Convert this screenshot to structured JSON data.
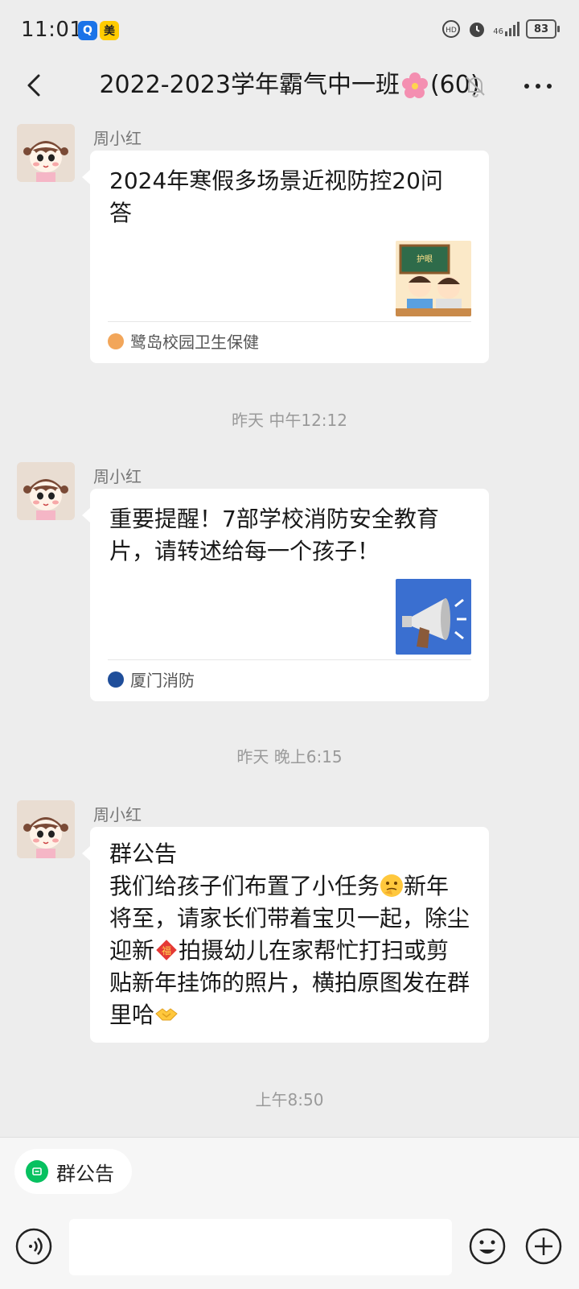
{
  "status_bar": {
    "time": "11:01",
    "badge_blue": "Q",
    "badge_yellow": "美",
    "network": "46",
    "battery": "83"
  },
  "header": {
    "title": "2022-2023学年霸气中一班",
    "member_count": "(60)",
    "icons": [
      "back-icon",
      "blossom-emoji",
      "mute-icon",
      "more-icon"
    ]
  },
  "messages": [
    {
      "sender": "周小红",
      "type": "link_card",
      "title": "2024年寒假多场景近视防控20问答",
      "source": "鹭岛校园卫生保健"
    },
    {
      "type": "timestamp",
      "text": "昨天 中午12:12"
    },
    {
      "sender": "周小红",
      "type": "link_card",
      "title": "重要提醒！7部学校消防安全教育片，请转述给每一个孩子！",
      "source": "厦门消防"
    },
    {
      "type": "timestamp",
      "text": "昨天 晚上6:15"
    },
    {
      "sender": "周小红",
      "type": "notice",
      "heading": "群公告",
      "p1": "我们给孩子们布置了小任务",
      "p2": "新年将至，请家长们带着宝贝一起，除尘迎新",
      "p3": "拍摄幼儿在家帮忙打扫或剪贴新年挂饰的照片，横拍原图发在群里哈"
    },
    {
      "type": "timestamp",
      "text": "上午8:50"
    }
  ],
  "bottom": {
    "notice_button": "群公告",
    "input_value": "",
    "icons": [
      "voice-icon",
      "emoji-icon",
      "plus-icon"
    ]
  },
  "colors": {
    "background": "#ededed",
    "bubble": "#ffffff",
    "wechat_green": "#07c160"
  }
}
